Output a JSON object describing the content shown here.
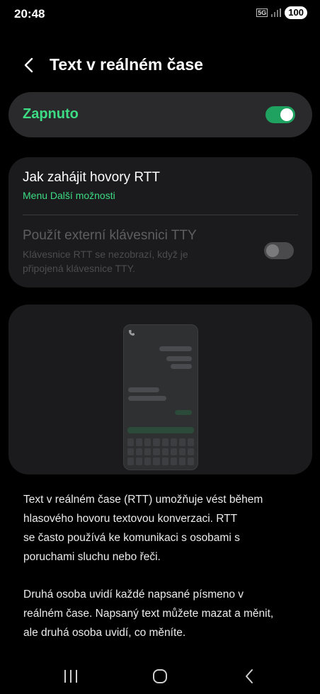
{
  "status_bar": {
    "time": "20:48",
    "network": "5G",
    "battery": "100"
  },
  "header": {
    "title": "Text v reálném čase"
  },
  "master_switch": {
    "label": "Zapnuto",
    "state": "on",
    "accent": "#3ddc84"
  },
  "settings": {
    "rtt_calls": {
      "title": "Jak zahájit hovory RTT",
      "subtitle": "Menu Další možnosti"
    },
    "tty_keyboard": {
      "title": "Použít externí klávesnici TTY",
      "subtitle": "Klávesnice RTT se nezobrazí, když je připojená klávesnice TTY.",
      "state": "off",
      "enabled": false
    }
  },
  "description": {
    "p1_lines": [
      "Text v reálném čase (RTT) umožňuje vést během",
      "hlasového hovoru textovou konverzaci. RTT",
      "se často používá ke komunikaci s osobami s",
      "poruchami sluchu nebo řeči."
    ],
    "p2_lines": [
      "Druhá osoba uvidí každé napsané písmeno v",
      "reálném čase. Napsaný text můžete mazat a měnit,",
      "ale druhá osoba uvidí, co měníte."
    ]
  },
  "icons": {
    "back": "back-arrow-icon",
    "phone": "phone-icon",
    "recents": "recents-icon",
    "home": "home-icon",
    "nav_back": "back-icon"
  }
}
